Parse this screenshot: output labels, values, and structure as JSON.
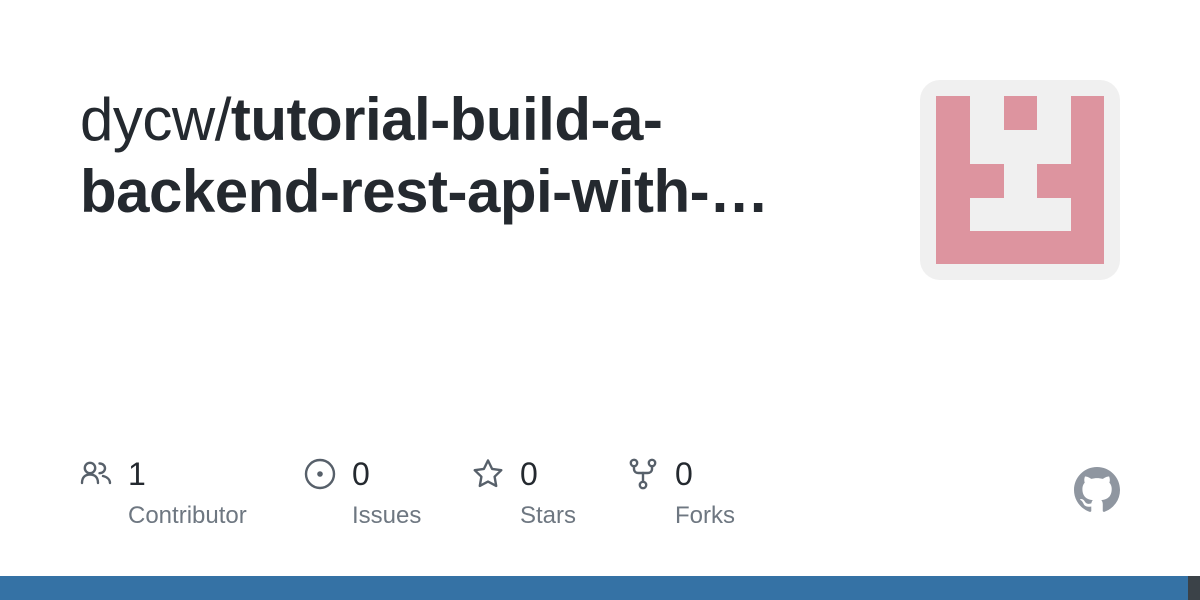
{
  "repo": {
    "owner_prefix": "dycw/",
    "name_line1": "tutorial-build-a-",
    "name_line2": "backend-rest-api-with-…"
  },
  "stats": [
    {
      "count": "1",
      "label": "Contributor",
      "icon": "people-icon"
    },
    {
      "count": "0",
      "label": "Issues",
      "icon": "issue-opened-icon"
    },
    {
      "count": "0",
      "label": "Stars",
      "icon": "star-icon"
    },
    {
      "count": "0",
      "label": "Forks",
      "icon": "repo-forked-icon"
    }
  ],
  "colors": {
    "text_primary": "#24292f",
    "text_secondary": "#6e7781",
    "icon": "#57606a",
    "avatar_bg": "#f0f0f0",
    "avatar_fg": "#dd949f",
    "language_bar": "#3572a5",
    "language_bar_secondary": "#3b4248",
    "github_logo": "#8f96a0"
  }
}
